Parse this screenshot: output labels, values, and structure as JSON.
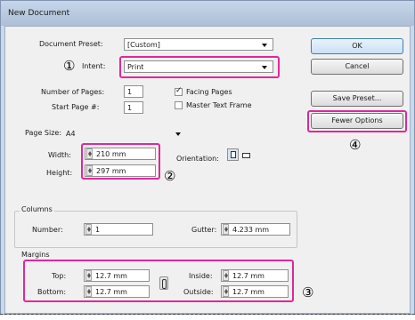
{
  "window": {
    "title": "New Document"
  },
  "document_preset": {
    "label": "Document Preset:",
    "value": "[Custom]"
  },
  "intent": {
    "label": "Intent:",
    "value": "Print"
  },
  "pages": {
    "number_label": "Number of Pages:",
    "number_value": "1",
    "start_label": "Start Page #:",
    "start_value": "1",
    "facing_pages": {
      "label": "Facing Pages",
      "checked": true
    },
    "master_text_frame": {
      "label": "Master Text Frame",
      "checked": false
    }
  },
  "page_size": {
    "label": "Page Size:",
    "value": "A4"
  },
  "dimensions": {
    "width_label": "Width:",
    "width_value": "210 mm",
    "height_label": "Height:",
    "height_value": "297 mm",
    "orientation_label": "Orientation:"
  },
  "columns": {
    "group_title": "Columns",
    "number_label": "Number:",
    "number_value": "1",
    "gutter_label": "Gutter:",
    "gutter_value": "4.233 mm"
  },
  "margins": {
    "group_title": "Margins",
    "top_label": "Top:",
    "top_value": "12.7 mm",
    "bottom_label": "Bottom:",
    "bottom_value": "12.7 mm",
    "inside_label": "Inside:",
    "inside_value": "12.7 mm",
    "outside_label": "Outside:",
    "outside_value": "12.7 mm"
  },
  "buttons": {
    "ok": "OK",
    "cancel": "Cancel",
    "save_preset": "Save Preset...",
    "fewer_options": "Fewer Options"
  },
  "annotations": {
    "m1": "①",
    "m2": "②",
    "m3": "③",
    "m4": "④",
    "highlight_color": "#e0289b"
  }
}
